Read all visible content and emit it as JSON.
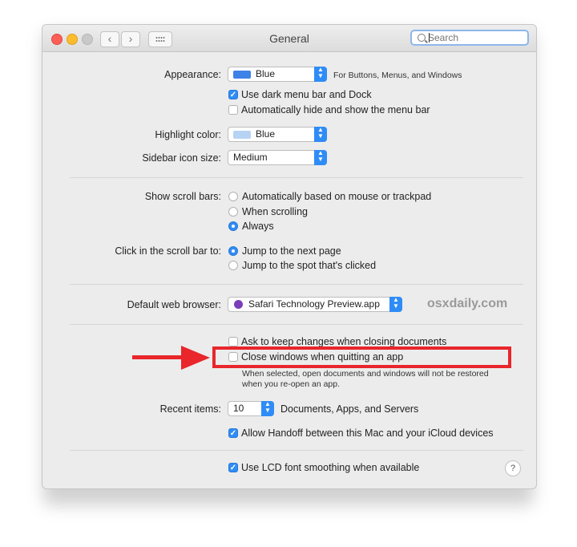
{
  "window": {
    "title": "General"
  },
  "search": {
    "placeholder": "Search"
  },
  "appearance": {
    "label": "Appearance:",
    "value": "Blue",
    "note": "For Buttons, Menus, and Windows",
    "swatch_color": "#3d82e6"
  },
  "dark_menu": {
    "label": "Use dark menu bar and Dock",
    "checked": true
  },
  "auto_hide": {
    "label": "Automatically hide and show the menu bar",
    "checked": false
  },
  "highlight": {
    "label": "Highlight color:",
    "value": "Blue",
    "swatch_color": "#b7d3f4"
  },
  "sidebar_icon": {
    "label": "Sidebar icon size:",
    "value": "Medium"
  },
  "scroll_bars": {
    "label": "Show scroll bars:",
    "options": [
      "Automatically based on mouse or trackpad",
      "When scrolling",
      "Always"
    ],
    "selected": "Always"
  },
  "click_scroll": {
    "label": "Click in the scroll bar to:",
    "options": [
      "Jump to the next page",
      "Jump to the spot that's clicked"
    ],
    "selected": "Jump to the next page"
  },
  "browser": {
    "label": "Default web browser:",
    "value": "Safari Technology Preview.app"
  },
  "watermark": "osxdaily.com",
  "ask_keep": {
    "label": "Ask to keep changes when closing documents",
    "checked": false
  },
  "close_windows": {
    "label": "Close windows when quitting an app",
    "checked": false,
    "desc1": "When selected, open documents and windows will not be restored",
    "desc2": "when you re-open an app."
  },
  "recent": {
    "label": "Recent items:",
    "value": "10",
    "suffix": "Documents, Apps, and Servers"
  },
  "handoff": {
    "label": "Allow Handoff between this Mac and your iCloud devices",
    "checked": true
  },
  "lcd": {
    "label": "Use LCD font smoothing when available",
    "checked": true
  },
  "help": "?",
  "nav": {
    "back": "‹",
    "forward": "›"
  },
  "annotation_color": "#e8262b"
}
